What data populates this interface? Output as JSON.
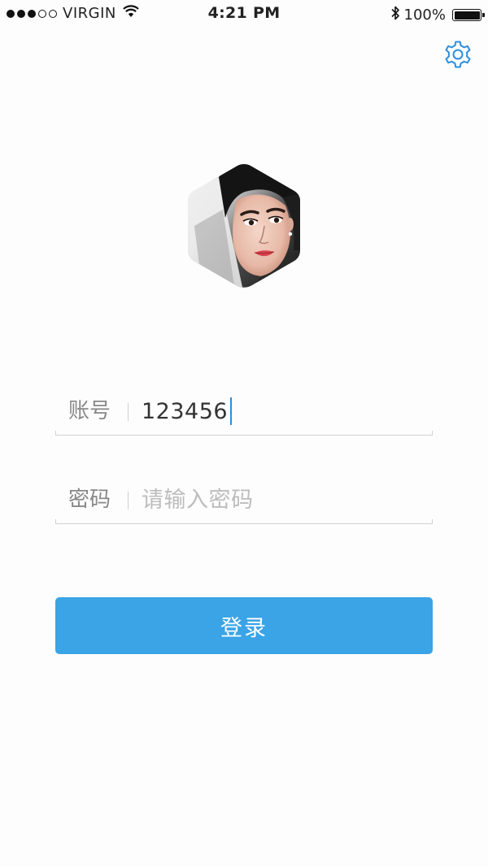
{
  "status_bar": {
    "carrier": "VIRGIN",
    "time": "4:21 PM",
    "battery_text": "100%",
    "battery_level": 1.0,
    "signal_bars_filled": 3,
    "signal_bars_total": 5
  },
  "header": {
    "settings_icon": "gear-icon"
  },
  "avatar": {
    "shape": "hexagon"
  },
  "form": {
    "account_label": "账号",
    "account_value": "123456",
    "password_label": "密码",
    "password_placeholder": "请输入密码"
  },
  "login_button": {
    "label": "登录"
  },
  "colors": {
    "accent": "#3aa4e6",
    "icon": "#2b8fde",
    "background": "#fdfdfd"
  }
}
